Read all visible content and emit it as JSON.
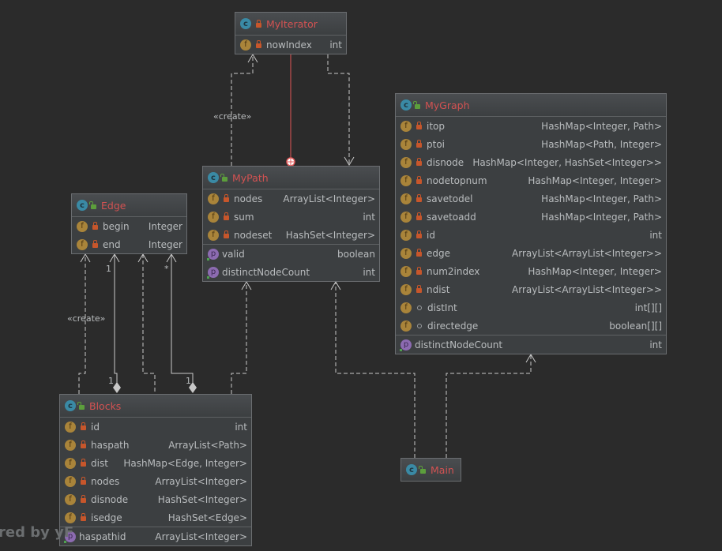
{
  "colors": {
    "background": "#2b2b2b",
    "box": "#3c3f41",
    "class_name": "#d25252",
    "line": "#c8c8c8",
    "inner_class_link": "#e05555"
  },
  "watermark": "red by yF",
  "classes": [
    {
      "name": "MyIterator",
      "visibility": "private",
      "fields": [
        {
          "name": "nowIndex",
          "type": "int",
          "access": "private"
        }
      ],
      "properties": []
    },
    {
      "name": "MyPath",
      "visibility": "public",
      "fields": [
        {
          "name": "nodes",
          "type": "ArrayList<Integer>",
          "access": "private"
        },
        {
          "name": "sum",
          "type": "int",
          "access": "private"
        },
        {
          "name": "nodeset",
          "type": "HashSet<Integer>",
          "access": "private"
        }
      ],
      "properties": [
        {
          "name": "valid",
          "type": "boolean"
        },
        {
          "name": "distinctNodeCount",
          "type": "int"
        }
      ]
    },
    {
      "name": "Edge",
      "visibility": "public",
      "fields": [
        {
          "name": "begin",
          "type": "Integer",
          "access": "private"
        },
        {
          "name": "end",
          "type": "Integer",
          "access": "private"
        }
      ],
      "properties": []
    },
    {
      "name": "MyGraph",
      "visibility": "public",
      "fields": [
        {
          "name": "itop",
          "type": "HashMap<Integer, Path>",
          "access": "private"
        },
        {
          "name": "ptoi",
          "type": "HashMap<Path, Integer>",
          "access": "private"
        },
        {
          "name": "disnode",
          "type": "HashMap<Integer, HashSet<Integer>>",
          "access": "private"
        },
        {
          "name": "nodetopnum",
          "type": "HashMap<Integer, Integer>",
          "access": "private"
        },
        {
          "name": "savetodel",
          "type": "HashMap<Integer, Path>",
          "access": "private"
        },
        {
          "name": "savetoadd",
          "type": "HashMap<Integer, Path>",
          "access": "private"
        },
        {
          "name": "id",
          "type": "int",
          "access": "private"
        },
        {
          "name": "edge",
          "type": "ArrayList<ArrayList<Integer>>",
          "access": "private"
        },
        {
          "name": "num2index",
          "type": "HashMap<Integer, Integer>",
          "access": "private"
        },
        {
          "name": "ndist",
          "type": "ArrayList<ArrayList<Integer>>",
          "access": "private"
        },
        {
          "name": "distInt",
          "type": "int[][]",
          "access": "package"
        },
        {
          "name": "directedge",
          "type": "boolean[][]",
          "access": "package"
        }
      ],
      "properties": [
        {
          "name": "distinctNodeCount",
          "type": "int"
        }
      ]
    },
    {
      "name": "Blocks",
      "visibility": "public",
      "fields": [
        {
          "name": "id",
          "type": "int",
          "access": "private"
        },
        {
          "name": "haspath",
          "type": "ArrayList<Path>",
          "access": "private"
        },
        {
          "name": "dist",
          "type": "HashMap<Edge, Integer>",
          "access": "private"
        },
        {
          "name": "nodes",
          "type": "ArrayList<Integer>",
          "access": "private"
        },
        {
          "name": "disnode",
          "type": "HashSet<Integer>",
          "access": "private"
        },
        {
          "name": "isedge",
          "type": "HashSet<Edge>",
          "access": "private"
        }
      ],
      "properties": [
        {
          "name": "haspathid",
          "type": "ArrayList<Integer>"
        }
      ]
    },
    {
      "name": "Main",
      "visibility": "public",
      "fields": [],
      "properties": []
    }
  ],
  "relations": [
    {
      "from": "MyPath",
      "to": "MyIterator",
      "kind": "dependency",
      "label": "«create»"
    },
    {
      "from": "MyIterator",
      "to": "MyPath",
      "kind": "inner-class"
    },
    {
      "from": "MyIterator",
      "to": "MyPath",
      "kind": "dependency"
    },
    {
      "from": "Blocks",
      "to": "Edge",
      "kind": "dependency",
      "label": "«create»"
    },
    {
      "from": "Blocks",
      "to": "Edge",
      "kind": "aggregation",
      "source_multiplicity": "1",
      "target_multiplicity": "1"
    },
    {
      "from": "Blocks",
      "to": "Edge",
      "kind": "dependency"
    },
    {
      "from": "Blocks",
      "to": "Edge",
      "kind": "aggregation",
      "source_multiplicity": "1",
      "target_multiplicity": "*"
    },
    {
      "from": "Blocks",
      "to": "MyPath",
      "kind": "dependency"
    },
    {
      "from": "Main",
      "to": "MyPath",
      "kind": "dependency"
    },
    {
      "from": "Main",
      "to": "MyGraph",
      "kind": "dependency"
    }
  ]
}
